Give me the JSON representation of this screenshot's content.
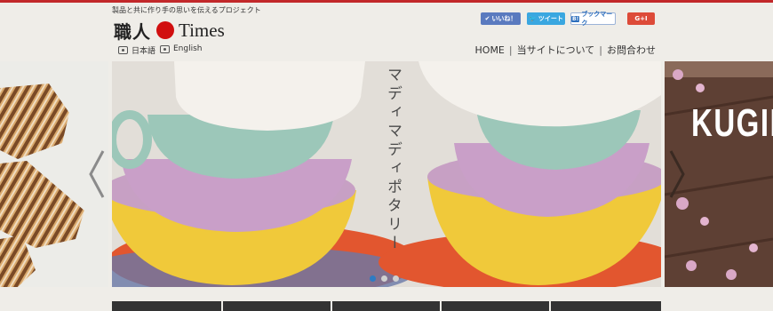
{
  "header": {
    "tagline": "製品と共に作り手の思いを伝えるプロジェクト",
    "logo_jp": "職人",
    "logo_en": "Times",
    "languages": [
      "日本語",
      "English"
    ],
    "social": {
      "facebook": "いいね！",
      "twitter": "ツイート",
      "hatena_b": "B!",
      "hatena": "ブックマーク",
      "gplus": "G+I"
    },
    "nav": [
      "HOME",
      "当サイトについて",
      "お問合わせ"
    ]
  },
  "slider": {
    "main_title": "マディマディポタリー",
    "right_title": "KUGII",
    "slide_count": 3,
    "active_slide": 1
  },
  "colors": {
    "accent": "#c2282a",
    "logo_dot": "#d10f0f",
    "active_dot": "#2e7bc3"
  }
}
